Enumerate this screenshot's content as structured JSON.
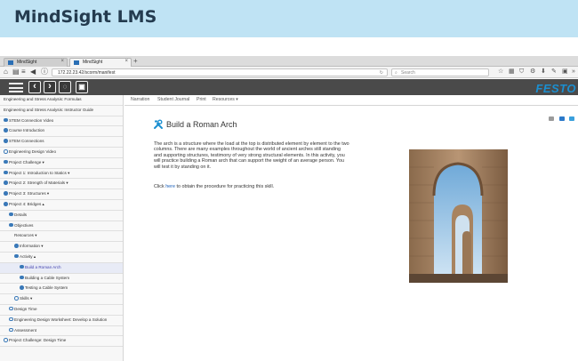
{
  "banner": {
    "title": "MindSight LMS"
  },
  "browser": {
    "tabs": [
      {
        "label": "MindSight"
      },
      {
        "label": "MindSight"
      }
    ],
    "url": "172.22.23.42/scorm/manifest",
    "search_placeholder": "Search"
  },
  "toolbar": {
    "brand": "FESTO"
  },
  "content_tabs": [
    "Narration",
    "Student Journal",
    "Print",
    "Resources ▾"
  ],
  "sidebar": {
    "items": [
      {
        "label": "Engineering and Stress Analysis: Formulas",
        "indent": 0,
        "icon": ""
      },
      {
        "label": "Engineering and Stress Analysis: Instructor Guide",
        "indent": 0,
        "icon": ""
      },
      {
        "label": "STEM Connection Video",
        "indent": 0,
        "icon": "fill"
      },
      {
        "label": "Course Introduction",
        "indent": 0,
        "icon": "fill"
      },
      {
        "label": "STEM Connections",
        "indent": 0,
        "icon": "fill"
      },
      {
        "label": "Engineering Design Video",
        "indent": 0,
        "icon": "ring"
      },
      {
        "label": "Project Challenge ▾",
        "indent": 0,
        "icon": "fill"
      },
      {
        "label": "Project 1: Introduction to Statics ▾",
        "indent": 0,
        "icon": "fill"
      },
      {
        "label": "Project 2: Strength of Materials ▾",
        "indent": 0,
        "icon": "fill"
      },
      {
        "label": "Project 3: Structures ▾",
        "indent": 0,
        "icon": "fill"
      },
      {
        "label": "Project 4: Bridges ▴",
        "indent": 0,
        "icon": "fill"
      },
      {
        "label": "Details",
        "indent": 1,
        "icon": "fill"
      },
      {
        "label": "Objectives",
        "indent": 1,
        "icon": "fill"
      },
      {
        "label": "Resources ▾",
        "indent": 2,
        "icon": ""
      },
      {
        "label": "Information ▾",
        "indent": 2,
        "icon": "fill"
      },
      {
        "label": "Activity ▴",
        "indent": 2,
        "icon": "fill"
      },
      {
        "label": "Build a Roman Arch",
        "indent": 3,
        "icon": "fill",
        "active": true
      },
      {
        "label": "Building a Cable System",
        "indent": 3,
        "icon": "fill"
      },
      {
        "label": "Testing a Cable System",
        "indent": 3,
        "icon": "fill"
      },
      {
        "label": "Skills ▾",
        "indent": 2,
        "icon": "ring"
      },
      {
        "label": "Design Time",
        "indent": 1,
        "icon": "ring"
      },
      {
        "label": "Engineering Design Worksheet: Develop a Solution",
        "indent": 1,
        "icon": "ring"
      },
      {
        "label": "Assessment",
        "indent": 1,
        "icon": "ring"
      },
      {
        "label": "Project Challenge: Design Time",
        "indent": 0,
        "icon": "ring"
      }
    ]
  },
  "main": {
    "title": "Build a Roman Arch",
    "paragraph": "The arch is a structure where the load at the top is distributed element by element to the two columns. There are many examples throughout the world of ancient arches still standing and supporting structures, testimony of very strong structural elements. In this activity, you will practice building a Roman arch that can support the weight of an average person. You will test it by standing on it.",
    "click_prefix": "Click ",
    "click_link": "here",
    "click_suffix": " to obtain the procedure for practicing this skill."
  },
  "colors": {
    "banner_bg": "#bfe3f4",
    "toolbar_bg": "#4a4a4a",
    "festo_blue": "#1b8fd0",
    "link": "#1a5fb8",
    "active_item": "#3f3fae"
  }
}
